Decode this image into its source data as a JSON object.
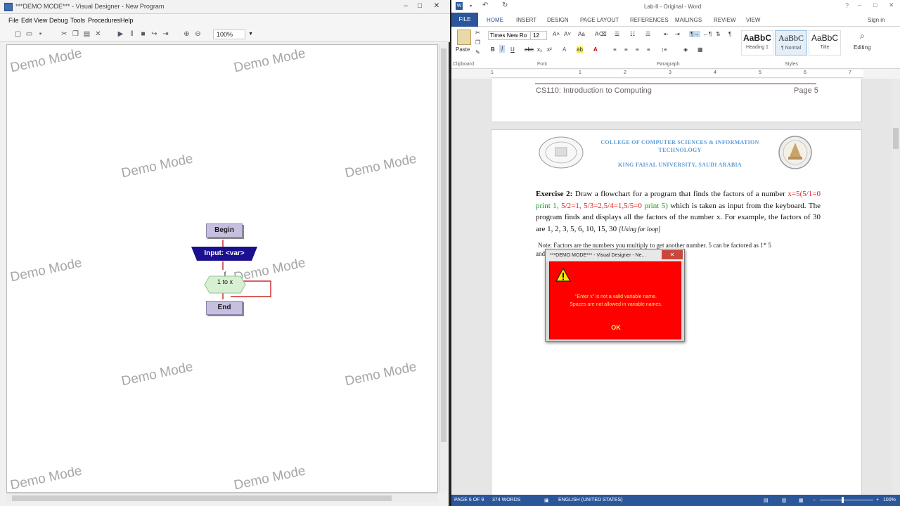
{
  "visual_designer": {
    "window_title": "***DEMO MODE*** - Visual Designer - New Program",
    "menu": [
      "File",
      "Edit",
      "View",
      "Debug",
      "Tools",
      "Procedures",
      "Help"
    ],
    "zoom": "100%",
    "watermark": "Demo Mode",
    "flowchart": {
      "begin": "Begin",
      "input": "Input: <var>",
      "loop_var": "f",
      "loop_range": "1 to x",
      "end": "End"
    }
  },
  "word": {
    "window_title": "Lab-II - Original - Word",
    "sign_in": "Sign in",
    "tabs": [
      "FILE",
      "HOME",
      "INSERT",
      "DESIGN",
      "PAGE LAYOUT",
      "REFERENCES",
      "MAILINGS",
      "REVIEW",
      "VIEW"
    ],
    "active_tab": "HOME",
    "font_name": "Times New Ro",
    "font_size": "12",
    "clipboard_label": "Clipboard",
    "paste_label": "Paste",
    "font_group_label": "Font",
    "paragraph_label": "Paragraph",
    "styles_label": "Styles",
    "editing_label": "Editing",
    "styles": [
      {
        "preview": "AaBbC",
        "name": "Heading 1"
      },
      {
        "preview": "AaBbC",
        "name": "¶ Normal"
      },
      {
        "preview": "AaBbC",
        "name": "Title"
      }
    ],
    "ruler_numbers": [
      "1",
      "1",
      "2",
      "3",
      "4",
      "5",
      "6",
      "7"
    ],
    "header_left": "CS110: Introduction to Computing",
    "header_right": "Page 5",
    "college_line1": "COLLEGE OF COMPUTER SCIENCES & INFORMATION",
    "college_line2": "TECHNOLOGY",
    "university_line": "KING FAISAL UNIVERSITY, SAUDI ARABIA",
    "exercise_label": "Exercise 2:",
    "exercise_text1": " Draw a flowchart for a program that finds the factors of a number",
    "exercise_x": "x=5",
    "exercise_red1": "(5/1=0 ",
    "exercise_green1": "print 1,",
    "exercise_red2": " 5/2=1, 5/3=2,5/4=1,5/5=0 ",
    "exercise_green2": "print 5)",
    "exercise_text2": " which is taken as input from the keyboard. The program finds and displays all the factors of the number x. For example, the factors of 30 are 1, 2, 3, 5, 6, 10, 15, 30 ",
    "exercise_italic": "[Using for loop]",
    "note_left": "Note: Factors are the numbers you multiply to get another number. 5 can be factored as 1* 5",
    "note_cont": "and",
    "status": {
      "page": "PAGE 6 OF 9",
      "words": "374 WORDS",
      "language": "ENGLISH (UNITED STATES)",
      "zoom": "100%"
    }
  },
  "dialog": {
    "title": "***DEMO MODE*** - Visual Designer - Ne...",
    "message_line1": "\"Enter x\" is not a valid variable name.",
    "message_line2": "Spaces are not allowed in variable names.",
    "ok": "OK"
  },
  "colors": {
    "dialog_bg": "#ff0000",
    "dialog_text": "#f7e36a",
    "word_accent": "#2b579a",
    "flow_term": "#c7bfe0",
    "flow_input": "#1a0f8f",
    "flow_loop": "#d7f0d2"
  }
}
